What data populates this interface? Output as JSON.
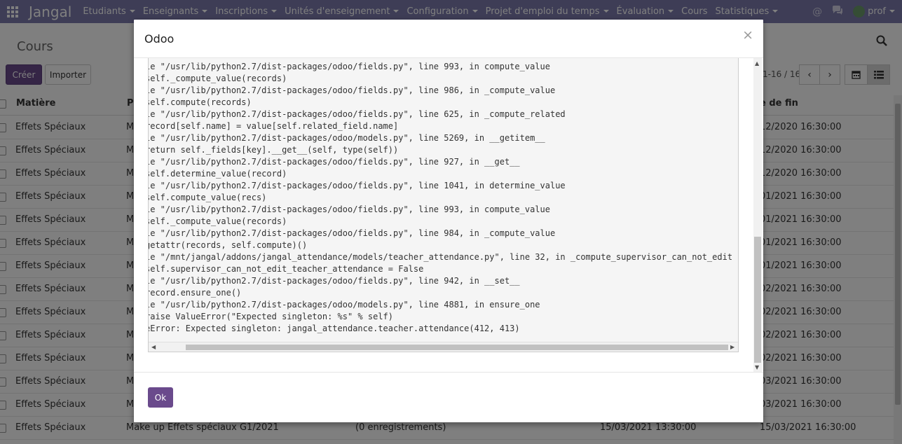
{
  "navbar": {
    "brand": "Jangal",
    "menu": [
      "Etudiants",
      "Enseignants",
      "Inscriptions",
      "Unités d'enseignement",
      "Configuration",
      "Projet d'emploi du temps",
      "Évaluation",
      "Cours",
      "Statistiques"
    ],
    "menu_has_caret": [
      true,
      true,
      true,
      true,
      true,
      true,
      true,
      false,
      true
    ],
    "user": "prof",
    "icons": [
      "apps-icon",
      "at-icon",
      "chat-icon",
      "avatar",
      "chevron-down-icon"
    ]
  },
  "control_panel": {
    "title": "Cours",
    "create_label": "Créer",
    "import_label": "Importer",
    "pager_value": "1-16 / 16",
    "pager_prev": "‹",
    "pager_next": "›"
  },
  "list": {
    "headers": [
      "Matière",
      "P",
      "e de fin"
    ],
    "rows": [
      {
        "subject": "Effets Spéciaux",
        "name": "M",
        "count": "",
        "start": "",
        "end": "12/2020 16:30:00"
      },
      {
        "subject": "Effets Spéciaux",
        "name": "M",
        "count": "",
        "start": "",
        "end": "12/2020 16:30:00"
      },
      {
        "subject": "Effets Spéciaux",
        "name": "M",
        "count": "",
        "start": "",
        "end": "12/2020 16:30:00"
      },
      {
        "subject": "Effets Spéciaux",
        "name": "M",
        "count": "",
        "start": "",
        "end": "01/2021 16:30:00"
      },
      {
        "subject": "Effets Spéciaux",
        "name": "M",
        "count": "",
        "start": "",
        "end": "01/2021 16:30:00"
      },
      {
        "subject": "Effets Spéciaux",
        "name": "M",
        "count": "",
        "start": "",
        "end": "01/2021 16:30:00"
      },
      {
        "subject": "Effets Spéciaux",
        "name": "M",
        "count": "",
        "start": "",
        "end": "01/2021 16:30:00"
      },
      {
        "subject": "Effets Spéciaux",
        "name": "M",
        "count": "",
        "start": "",
        "end": "02/2021 16:30:00"
      },
      {
        "subject": "Effets Spéciaux",
        "name": "M",
        "count": "",
        "start": "",
        "end": "02/2021 16:30:00"
      },
      {
        "subject": "Effets Spéciaux",
        "name": "M",
        "count": "",
        "start": "",
        "end": "02/2021 16:30:00"
      },
      {
        "subject": "Effets Spéciaux",
        "name": "M",
        "count": "",
        "start": "",
        "end": "02/2021 16:30:00"
      },
      {
        "subject": "Effets Spéciaux",
        "name": "M",
        "count": "",
        "start": "",
        "end": "03/2021 16:30:00"
      },
      {
        "subject": "Effets Spéciaux",
        "name": "M",
        "count": "",
        "start": "",
        "end": "03/2021 16:30:00"
      },
      {
        "subject": "Effets Spéciaux",
        "name": "Make up Effets spéciaux G1/2021",
        "count": "(0 enregistrements)",
        "start": "15/03/2021 13:30:00",
        "end": "15/03/2021 16:30:00"
      }
    ]
  },
  "dialog": {
    "title": "Odoo",
    "close": "×",
    "ok_label": "Ok",
    "traceback": [
      "le \"/usr/lib/python2.7/dist-packages/odoo/fields.py\", line 993, in compute_value",
      "self._compute_value(records)",
      "le \"/usr/lib/python2.7/dist-packages/odoo/fields.py\", line 986, in _compute_value",
      "self.compute(records)",
      "le \"/usr/lib/python2.7/dist-packages/odoo/fields.py\", line 625, in _compute_related",
      "record[self.name] = value[self.related_field.name]",
      "le \"/usr/lib/python2.7/dist-packages/odoo/models.py\", line 5269, in __getitem__",
      "return self._fields[key].__get__(self, type(self))",
      "le \"/usr/lib/python2.7/dist-packages/odoo/fields.py\", line 927, in __get__",
      "self.determine_value(record)",
      "le \"/usr/lib/python2.7/dist-packages/odoo/fields.py\", line 1041, in determine_value",
      "self.compute_value(recs)",
      "le \"/usr/lib/python2.7/dist-packages/odoo/fields.py\", line 993, in compute_value",
      "self._compute_value(records)",
      "le \"/usr/lib/python2.7/dist-packages/odoo/fields.py\", line 984, in _compute_value",
      "getattr(records, self.compute)()",
      "le \"/mnt/jangal/addons/jangal_attendance/models/teacher_attendance.py\", line 32, in _compute_supervisor_can_not_edit",
      "self.supervisor_can_not_edit_teacher_attendance = False",
      "le \"/usr/lib/python2.7/dist-packages/odoo/fields.py\", line 942, in __set__",
      "record.ensure_one()",
      "le \"/usr/lib/python2.7/dist-packages/odoo/models.py\", line 4881, in ensure_one",
      "raise ValueError(\"Expected singleton: %s\" % self)",
      "eError: Expected singleton: jangal_attendance.teacher.attendance(412, 413)"
    ]
  },
  "colors": {
    "navbar": "#7c7bad",
    "primary": "#6a4a8c"
  }
}
